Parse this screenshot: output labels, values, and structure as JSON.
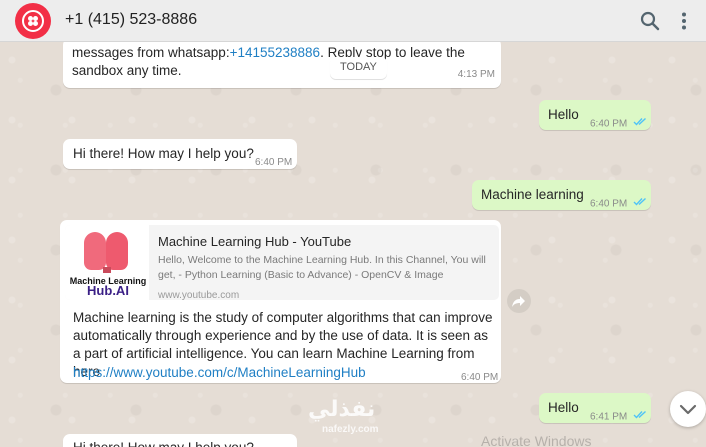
{
  "header": {
    "contact_name": "+1 (415) 523-8886",
    "avatar_icon": "twilio-logo-icon",
    "search_icon": "search-icon",
    "menu_icon": "more-vertical-icon"
  },
  "date_divider": "TODAY",
  "messages": [
    {
      "text_before": "messages from whatsapp:",
      "link": "+14155238886",
      "text_after": ". Reply stop to leave the sandbox any time.",
      "time": "4:13 PM"
    },
    {
      "text": "Hello",
      "time": "6:40 PM"
    },
    {
      "text": "Hi there! How may I help you?",
      "time": "6:40 PM"
    },
    {
      "text": "Machine learning",
      "time": "6:40 PM"
    },
    {
      "preview": {
        "thumb_line1": "Machine Learning",
        "thumb_line2": "Hub.AI",
        "title": "Machine Learning Hub - YouTube",
        "description": "Hello, Welcome to the Machine Learning Hub. In this Channel, You will get, - Python Learning (Basic to Advance) - OpenCV & Image",
        "url": "www.youtube.com"
      },
      "text": "Machine learning is the study of computer algorithms that can improve automatically through experience and by the use of data. It is seen as a part of artificial intelligence. You can learn Machine Learning from here",
      "link": "https://www.youtube.com/c/MachineLearningHub",
      "time": "6:40 PM"
    },
    {
      "text": "Hello",
      "time": "6:41 PM"
    },
    {
      "text": "Hi there! How may I help you?"
    }
  ],
  "overlays": {
    "watermark": "نفذلي",
    "watermark_sub": "nafezly.com",
    "activate": "Activate Windows"
  },
  "colors": {
    "chat_background": "#e5ddd5",
    "incoming_bubble": "#ffffff",
    "outgoing_bubble": "#dcf8c6",
    "read_ticks": "#4fc3f7",
    "avatar": "#f22f46"
  }
}
